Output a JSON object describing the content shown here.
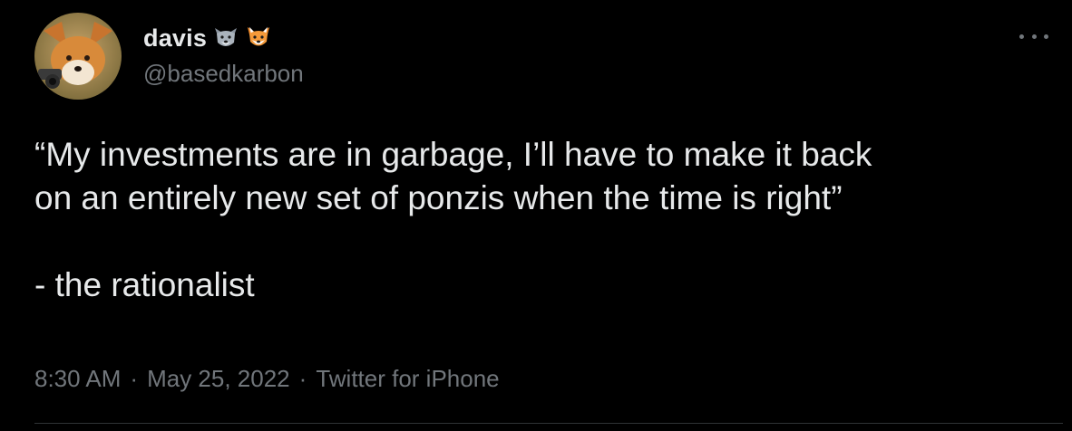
{
  "tweet": {
    "display_name": "davis",
    "name_emojis": [
      "wolf-emoji",
      "fox-emoji"
    ],
    "handle": "@basedkarbon",
    "text": "“My investments are in garbage, I’ll have to make it back\non an entirely new set of ponzis when the time is right”\n\n- the rationalist",
    "time": "8:30 AM",
    "separator": "·",
    "date": "May 25, 2022",
    "source": "Twitter for iPhone",
    "more_icon": "more-horizontal-icon"
  },
  "colors": {
    "background": "#000000",
    "primary_text": "#e7e9ea",
    "secondary_text": "#71767b",
    "divider": "#2f3336"
  }
}
